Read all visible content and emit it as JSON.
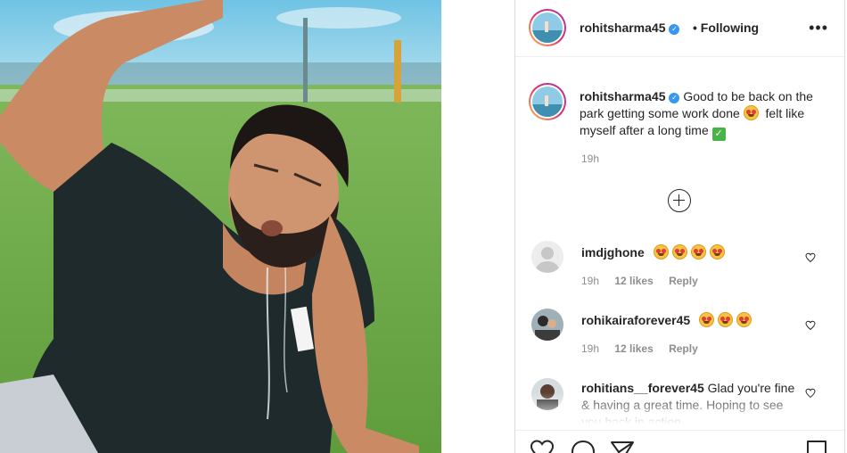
{
  "post": {
    "username": "rohitsharma45",
    "verified_mark": "✓",
    "follow_label": "• Following",
    "more_label": "•••",
    "caption_text_1": "Good to be back on the park getting some work done",
    "caption_text_2": "felt like myself after a long time",
    "check_mark": "✓",
    "caption_time": "19h"
  },
  "comments": [
    {
      "username": "imdjghone",
      "time": "19h",
      "likes": "12 likes",
      "reply": "Reply"
    },
    {
      "username": "rohikairaforever45",
      "time": "19h",
      "likes": "12 likes",
      "reply": "Reply"
    },
    {
      "username": "rohitians__forever45",
      "text": "Glad you're fine & having a great time. Hoping to see you back in action"
    }
  ],
  "icons": {
    "more": "more-options-icon",
    "load_more": "plus-circle-icon",
    "like": "heart-icon",
    "comment": "comment-icon",
    "share": "share-icon",
    "save": "bookmark-icon"
  },
  "colors": {
    "verified": "#3897f0",
    "meta": "#8e8e8e",
    "text": "#262626"
  }
}
